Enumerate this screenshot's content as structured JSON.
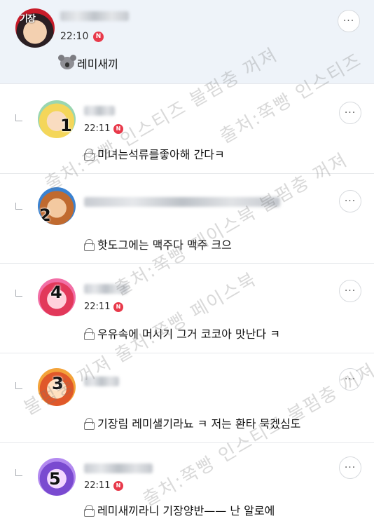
{
  "post": {
    "avatar_text": "기장",
    "time": "22:10",
    "new_badge": "N",
    "content": "레미새끼",
    "emoji_icon": "koala-icon"
  },
  "comments": [
    {
      "avatar_number": "1",
      "time": "22:11",
      "new_badge": "N",
      "text": "미녀는석류를좋아해 간다ㅋ",
      "avatar_colors": [
        "#f4d65a",
        "#e26aa0",
        "#9ad6b0"
      ]
    },
    {
      "avatar_number": "2",
      "time": "",
      "new_badge": "",
      "text": "핫도그에는 맥주다 맥주 크으",
      "avatar_colors": [
        "#c06a2f",
        "#3b82d0",
        "#f3c9a0"
      ]
    },
    {
      "avatar_number": "4",
      "time": "22:11",
      "new_badge": "N",
      "text": "우유속에 머시기 그거 코코아 맛난다 ㅋ",
      "avatar_colors": [
        "#e2385a",
        "#f26fa6",
        "#ffd1dc"
      ]
    },
    {
      "avatar_number": "3",
      "time": "",
      "new_badge": "",
      "text": "기장림 레미샐기라뇨 ㅋ 저는 환타 묵겠심도",
      "avatar_colors": [
        "#e0582a",
        "#f3a33a",
        "#ffe0c0"
      ]
    },
    {
      "avatar_number": "5",
      "time": "22:11",
      "new_badge": "N",
      "text": "레미새끼라니 기장양반—— 난 알로에",
      "avatar_colors": [
        "#7a4ad0",
        "#b38af0",
        "#f3d6ff"
      ]
    }
  ],
  "more_button_label": "···",
  "watermark_lines": [
    "출처:쭉빵 인스티즈 불펌충 꺼져",
    "출처:쭉빵 페이스북 불펌충 꺼져",
    "출처:쭉빵 인스티즈",
    "불펌충 꺼져 출처:쭉빵 페이스북",
    "출처:쭉빵 인스티즈 불펌충 꺼져"
  ],
  "colors": {
    "post_bg": "#eef3f9",
    "badge_red": "#e8394a",
    "divider": "#e6e8eb"
  }
}
